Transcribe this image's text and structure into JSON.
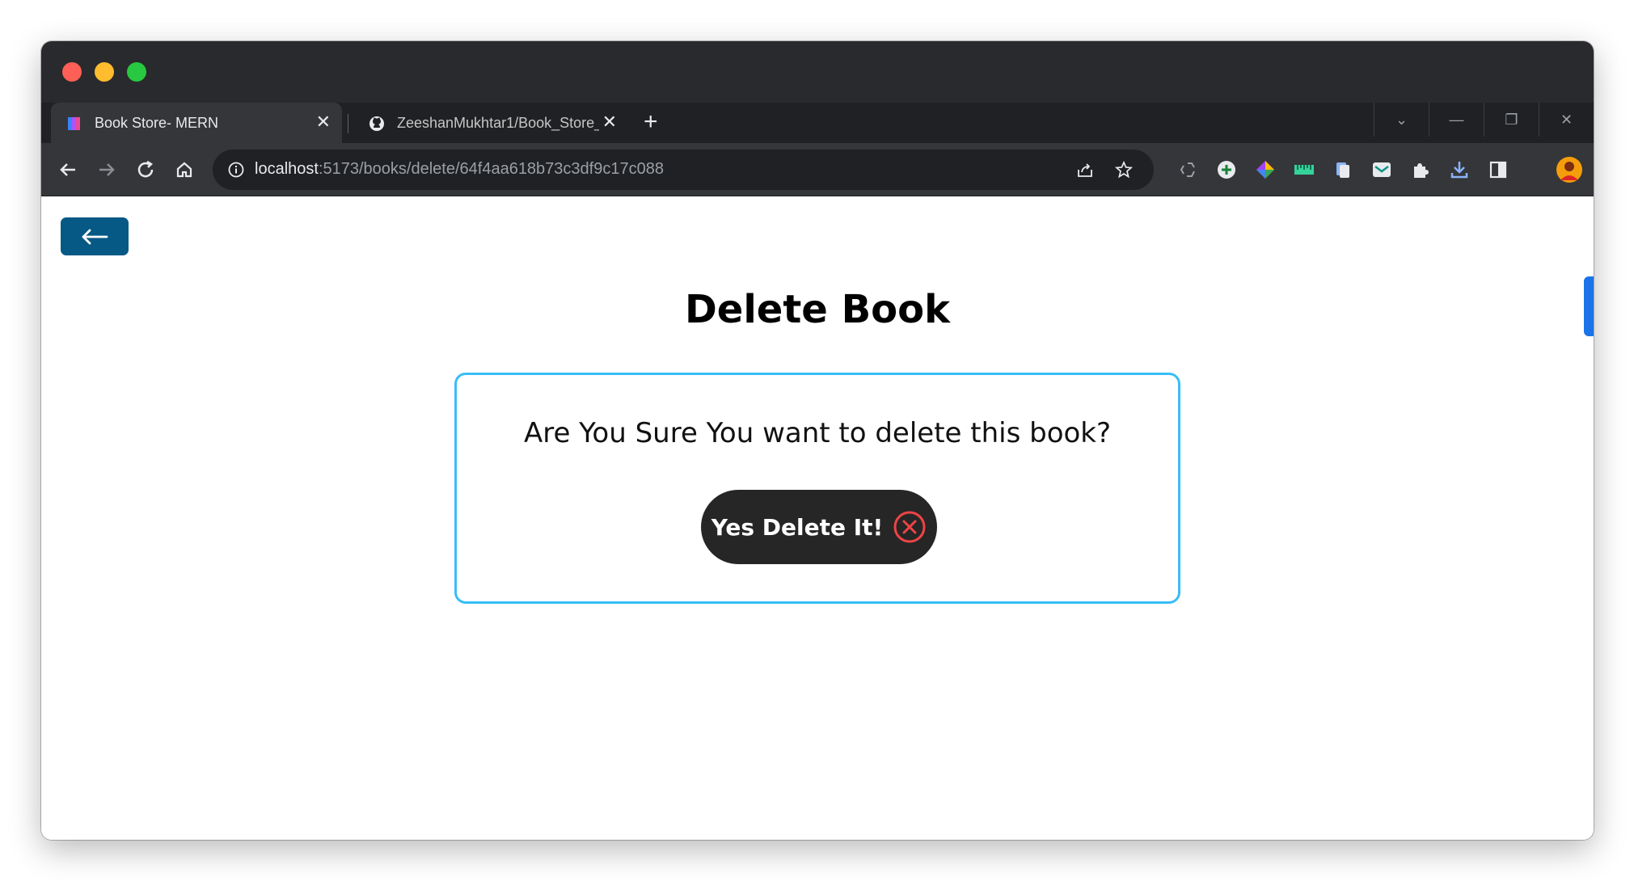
{
  "browser": {
    "tabs": [
      {
        "title": "Book Store- MERN",
        "favicon": "book-store-favicon",
        "active": true
      },
      {
        "title": "ZeeshanMukhtar1/Book_Store_",
        "favicon": "github-icon",
        "active": false
      }
    ],
    "address": {
      "host": "localhost",
      "path": ":5173/books/delete/64f4aa618b73c3df9c17c088"
    }
  },
  "page": {
    "title": "Delete Book",
    "confirm_text": "Are You Sure You want to delete this book?",
    "delete_button_label": "Yes Delete It!",
    "back_icon": "arrow-left-icon"
  },
  "colors": {
    "back_button": "#075985",
    "card_border": "#38bdf8",
    "delete_button": "#262626",
    "delete_icon": "#ef4444"
  }
}
